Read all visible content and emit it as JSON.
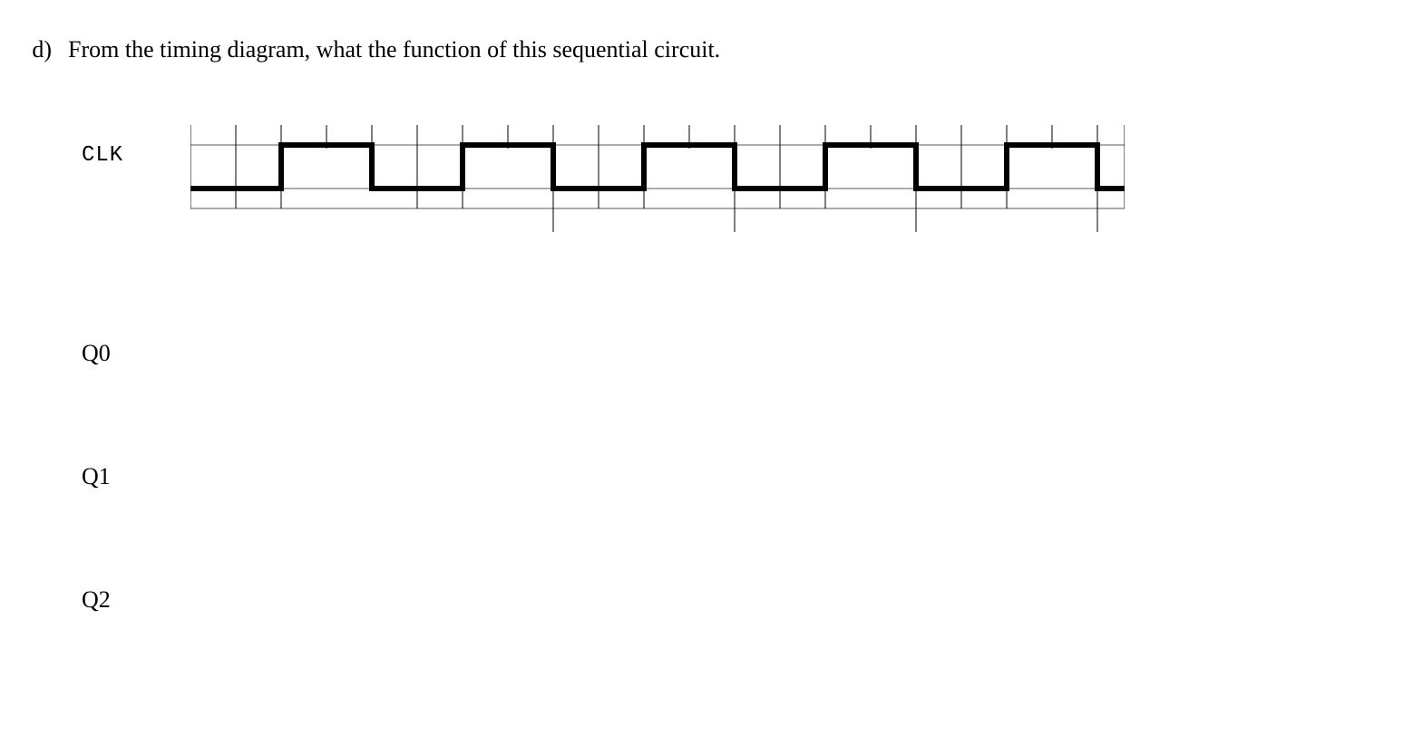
{
  "question": {
    "marker": "d)",
    "text": "From the timing diagram, what the function of this sequential circuit."
  },
  "signals": {
    "clk": "CLK",
    "q0": "Q0",
    "q1": "Q1",
    "q2": "Q2"
  },
  "clk_waveform": {
    "period_units": 4,
    "high_units": 2,
    "low_units": 2,
    "total_units": 20,
    "initial_low_units": 2,
    "levels": [
      0,
      0,
      1,
      1,
      0,
      0,
      1,
      1,
      0,
      0,
      1,
      1,
      0,
      0,
      1,
      1,
      0,
      0,
      1,
      1,
      0
    ]
  }
}
